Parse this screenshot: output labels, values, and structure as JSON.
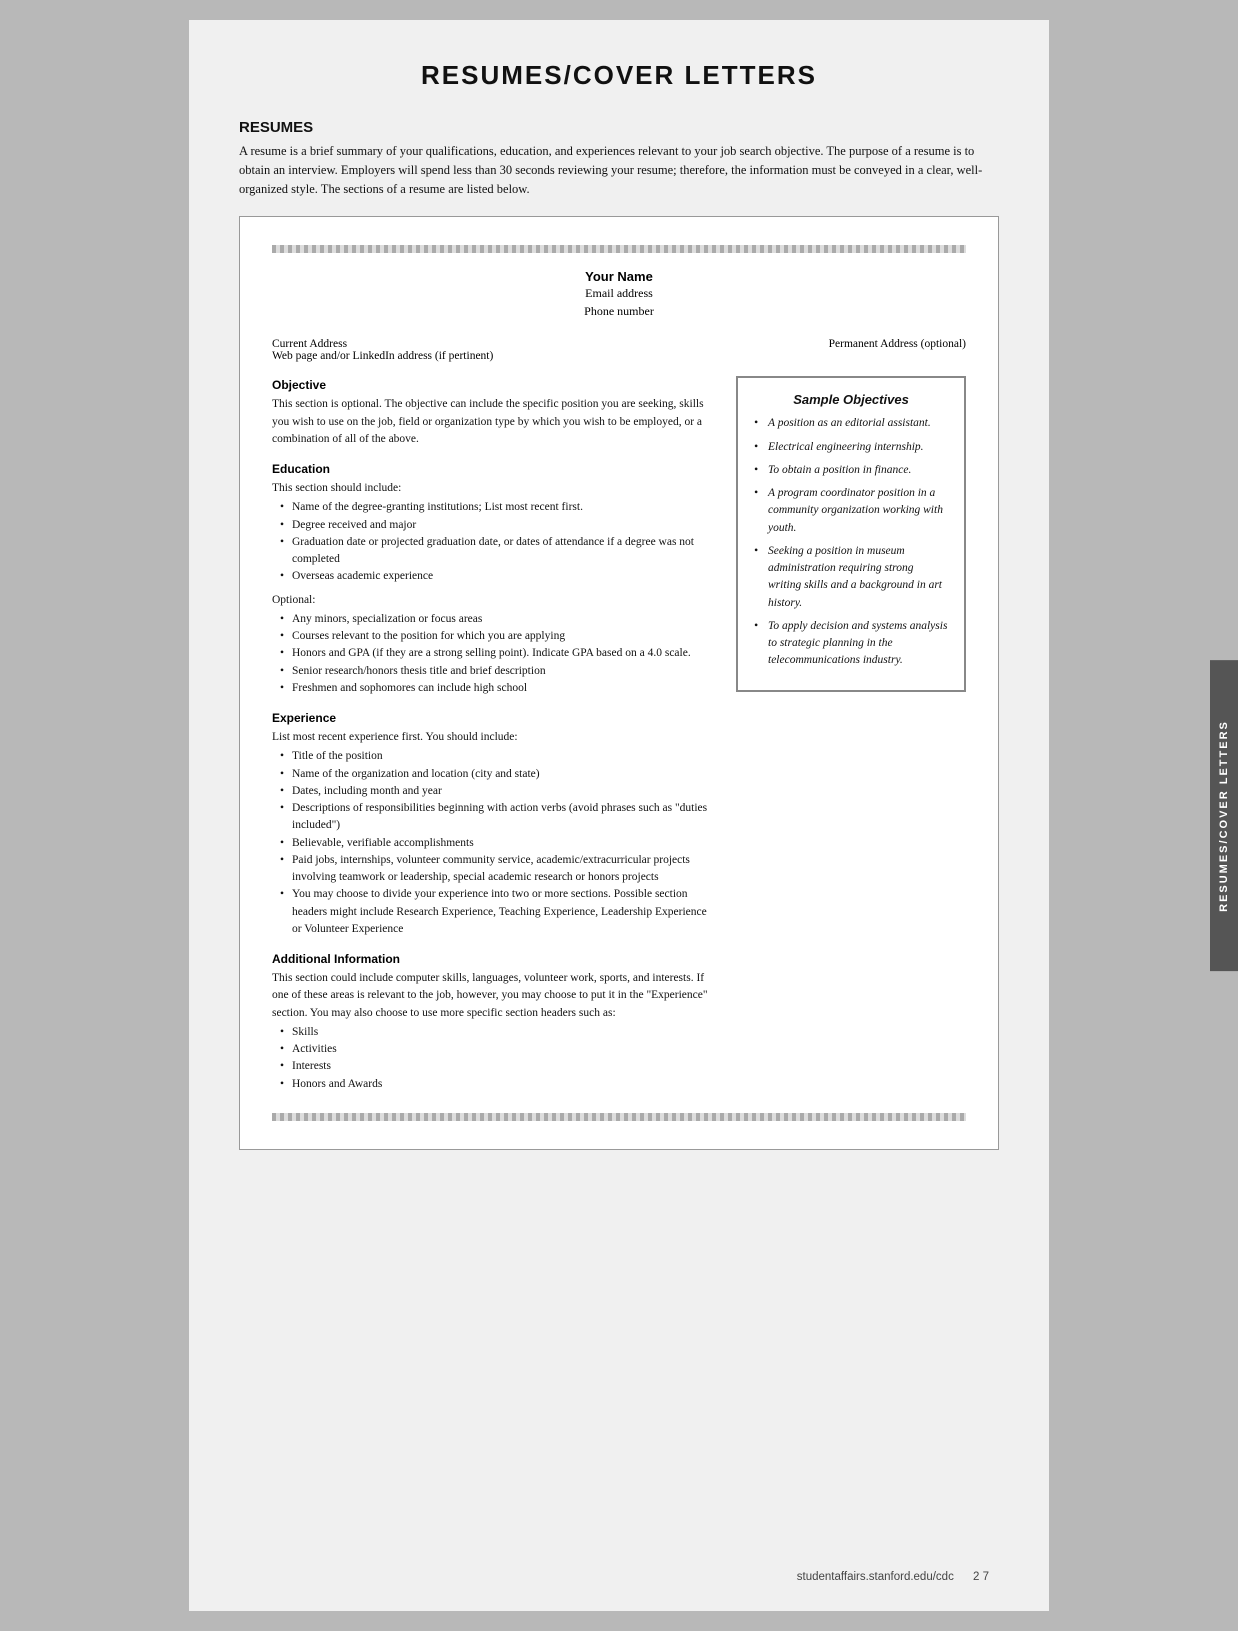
{
  "page": {
    "title": "RESUMES/COVER LETTERS",
    "footer_url": "studentaffairs.stanford.edu/cdc",
    "footer_page": "2 7",
    "side_tab_label": "RESUMES/COVER LETTERS"
  },
  "resumes_section": {
    "heading": "RESUMES",
    "intro": "A resume is a brief summary of your qualifications, education, and experiences relevant to your job search objective. The purpose of a resume is to obtain an interview. Employers will spend less than 30 seconds reviewing your resume; therefore, the information must be conveyed in a clear, well-organized style. The sections of a resume are listed below."
  },
  "resume_template": {
    "name": "Your Name",
    "email": "Email address",
    "phone": "Phone number",
    "current_address_label": "Current Address",
    "web_label": "Web page and/or LinkedIn address (if pertinent)",
    "permanent_address_label": "Permanent Address (optional)",
    "objective_title": "Objective",
    "objective_text": "This section is optional. The objective can include the specific position you are seeking, skills you wish to use on the job, field or organization type by which you wish to be employed, or a combination of all of the above.",
    "education_title": "Education",
    "education_intro": "This section should include:",
    "education_bullets": [
      "Name of the degree-granting institutions; List most recent first.",
      "Degree received and major",
      "Graduation date or projected graduation date, or dates of attendance if a degree was not completed",
      "Overseas academic experience"
    ],
    "education_optional_label": "Optional:",
    "education_optional_bullets": [
      "Any minors, specialization or focus areas",
      "Courses relevant to the position for which you are applying",
      "Honors and GPA (if they are a strong selling point). Indicate GPA based on a 4.0 scale.",
      "Senior research/honors thesis title and brief description",
      "Freshmen and sophomores can include high school"
    ],
    "experience_title": "Experience",
    "experience_intro": "List most recent experience first. You should include:",
    "experience_bullets": [
      "Title of the position",
      "Name of the organization and location (city and state)",
      "Dates, including month and year",
      "Descriptions of responsibilities beginning with action verbs (avoid phrases such as \"duties included\")",
      "Believable, verifiable accomplishments",
      "Paid jobs, internships, volunteer community service, academic/extracurricular projects involving teamwork or leadership, special academic research or honors projects",
      "You may choose to divide your experience into two or more sections. Possible section headers might include Research Experience, Teaching Experience, Leadership Experience or Volunteer Experience"
    ],
    "additional_title": "Additional Information",
    "additional_text": "This section could include computer skills, languages, volunteer work, sports, and interests. If one of these areas is relevant to the job, however, you may choose to put it in the \"Experience\" section. You may also choose to use more specific section headers such as:",
    "additional_bullets": [
      "Skills",
      "Activities",
      "Interests",
      "Honors and Awards"
    ]
  },
  "sample_objectives": {
    "title": "Sample Objectives",
    "items": [
      "A position as an editorial assistant.",
      "Electrical engineering internship.",
      "To obtain a position in finance.",
      "A program coordinator position in a community organization working with youth.",
      "Seeking a position in museum administration requiring strong writing skills and a background in art history.",
      "To apply decision and systems analysis to strategic planning in the telecommunications industry."
    ]
  }
}
